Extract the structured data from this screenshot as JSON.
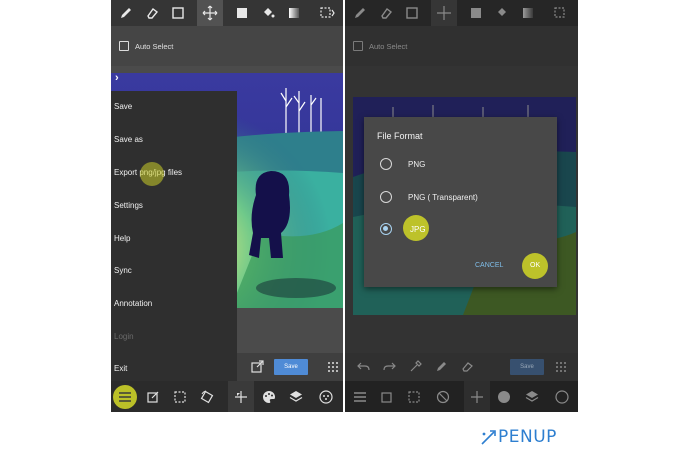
{
  "left_screen": {
    "sub_toolbar": {
      "auto_select_label": "Auto Select"
    },
    "menu": {
      "items": [
        {
          "label": "Save",
          "enabled": true
        },
        {
          "label": "Save as",
          "enabled": true
        },
        {
          "label": "Export png/jpg files",
          "enabled": true
        },
        {
          "label": "Settings",
          "enabled": true
        },
        {
          "label": "Help",
          "enabled": true
        },
        {
          "label": "Sync",
          "enabled": true
        },
        {
          "label": "Annotation",
          "enabled": true
        },
        {
          "label": "Login",
          "enabled": false
        },
        {
          "label": "Exit",
          "enabled": true
        }
      ]
    },
    "save_button_label": "Save"
  },
  "right_screen": {
    "sub_toolbar": {
      "auto_select_label": "Auto Select"
    },
    "save_button_label": "Save",
    "dialog": {
      "title": "File Format",
      "options": [
        {
          "label": "PNG",
          "selected": false
        },
        {
          "label": "PNG ( Transparent)",
          "selected": false
        },
        {
          "label": "JPG",
          "selected": true
        }
      ],
      "cancel_label": "CANCEL",
      "ok_label": "OK"
    }
  },
  "brand": {
    "logo_text": "PENUP"
  },
  "colors": {
    "highlight": "#c8cd28",
    "accent_button": "#4f8bd6",
    "dialog_accent": "#7fbde8",
    "logo_blue": "#2e7fd0"
  }
}
